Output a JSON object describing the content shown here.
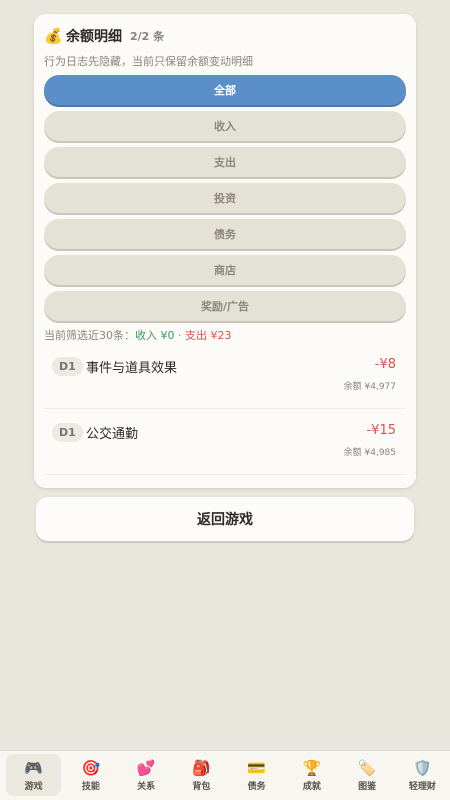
{
  "header": {
    "icon": "money-bag-icon",
    "emoji": "💰",
    "title": "余额明细",
    "count": "2/2 条"
  },
  "subtitle": "行为日志先隐藏，当前只保留余额变动明细",
  "filters": [
    {
      "label": "全部",
      "active": true
    },
    {
      "label": "收入",
      "active": false
    },
    {
      "label": "支出",
      "active": false
    },
    {
      "label": "投资",
      "active": false
    },
    {
      "label": "债务",
      "active": false
    },
    {
      "label": "商店",
      "active": false
    },
    {
      "label": "奖励/广告",
      "active": false
    }
  ],
  "summary": {
    "prefix": "当前筛选近30条：",
    "income": "收入 ¥0",
    "sep": " · ",
    "expense": "支出 ¥23"
  },
  "entries": [
    {
      "day": "D1",
      "name": "事件与道具效果",
      "amount": "-¥8",
      "balance": "余额 ¥4,977"
    },
    {
      "day": "D1",
      "name": "公交通勤",
      "amount": "-¥15",
      "balance": "余额 ¥4,985"
    }
  ],
  "back_button": "返回游戏",
  "nav": [
    {
      "label": "游戏",
      "icon": "gamepad-icon",
      "glyph": "🎮",
      "active": true
    },
    {
      "label": "技能",
      "icon": "target-icon",
      "glyph": "🎯",
      "active": false
    },
    {
      "label": "关系",
      "icon": "hearts-icon",
      "glyph": "💕",
      "active": false
    },
    {
      "label": "背包",
      "icon": "backpack-icon",
      "glyph": "🎒",
      "active": false
    },
    {
      "label": "债务",
      "icon": "credit-card-icon",
      "glyph": "💳",
      "active": false
    },
    {
      "label": "成就",
      "icon": "trophy-icon",
      "glyph": "🏆",
      "active": false
    },
    {
      "label": "图鉴",
      "icon": "tag-icon",
      "glyph": "🏷️",
      "active": false
    },
    {
      "label": "轻理财",
      "icon": "shield-icon",
      "glyph": "🛡️",
      "active": false
    }
  ],
  "colors": {
    "accent": "#5a8fc9",
    "income": "#3a9a6a",
    "expense": "#d9534f"
  }
}
